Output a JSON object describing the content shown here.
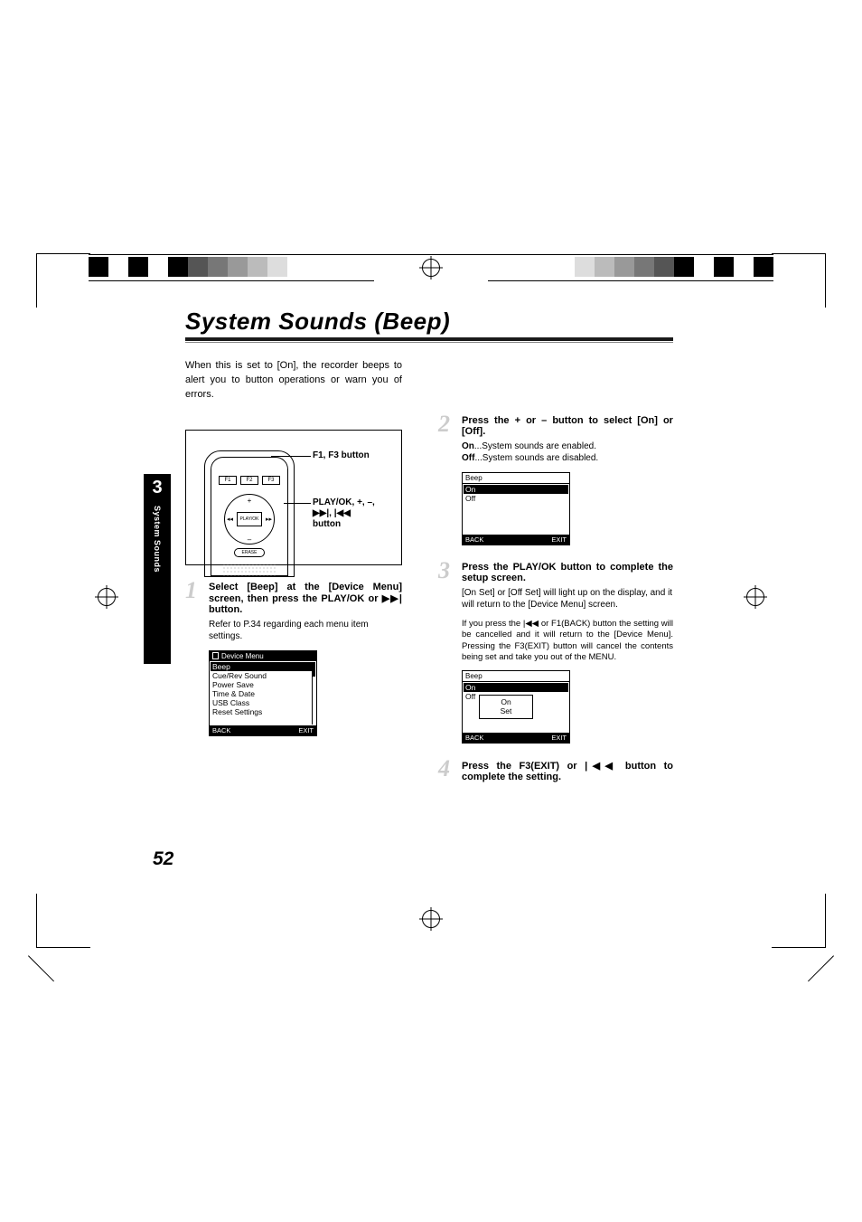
{
  "page": {
    "title": "System Sounds (Beep)",
    "intro": "When this is set to [On], the recorder beeps to alert you to button operations or warn you of errors.",
    "page_number": "52",
    "chapter_number": "3",
    "side_label": "System Sounds"
  },
  "illustration": {
    "fkeys": [
      "F1",
      "F2",
      "F3"
    ],
    "dpad_center": "PLAY/OK",
    "erase": "ERASE",
    "callout_top": "F1, F3 button",
    "callout_mid_l1": "PLAY/OK, +, –,",
    "callout_mid_l2": "▶▶|, |◀◀",
    "callout_mid_l3": "button"
  },
  "steps": {
    "s1": {
      "num": "1",
      "line1_a": "Select [Beep] at the [Device Menu] screen, then press the ",
      "line1_b": "PLAY/OK",
      "line1_c": " or ",
      "line1_d": "▶▶|",
      "line1_e": " button.",
      "sub": "Refer to P.34 regarding each menu item settings."
    },
    "s2": {
      "num": "2",
      "line_a": "Press the ",
      "line_b": "+",
      "line_c": " or ",
      "line_d": "–",
      "line_e": " button to select [On] or [Off].",
      "sub_on_label": "On",
      "sub_on_text": "...System sounds are enabled.",
      "sub_off_label": "Off",
      "sub_off_text": "...System sounds are disabled."
    },
    "s3": {
      "num": "3",
      "line_a": "Press the ",
      "line_b": "PLAY/OK",
      "line_c": " button to complete the setup screen.",
      "sub1": "[On Set] or [Off Set] will light up on the display, and it will return to the [Device Menu] screen.",
      "sub2": "If you press the |◀◀ or F1(BACK) button the setting will be cancelled and it will return to the [Device Menu]. Pressing the F3(EXIT) button will cancel the contents being set and take you out of the MENU."
    },
    "s4": {
      "num": "4",
      "line_a": "Press the ",
      "line_b": "F3(EXIT)",
      "line_c": " or ",
      "line_d": "|◀◀",
      "line_e": " button to complete the setting."
    }
  },
  "lcd1": {
    "title": "Device Menu",
    "items": [
      "Beep",
      "Cue/Rev Sound",
      "Power Save",
      "Time & Date",
      "USB Class",
      "Reset Settings"
    ],
    "back": "BACK",
    "exit": "EXIT"
  },
  "lcd2": {
    "title": "Beep",
    "items": [
      "On",
      "Off"
    ],
    "back": "BACK",
    "exit": "EXIT"
  },
  "lcd3": {
    "title": "Beep",
    "items": [
      "On",
      "Off"
    ],
    "popup_l1": "On",
    "popup_l2": "Set",
    "back": "BACK",
    "exit": "EXIT"
  }
}
